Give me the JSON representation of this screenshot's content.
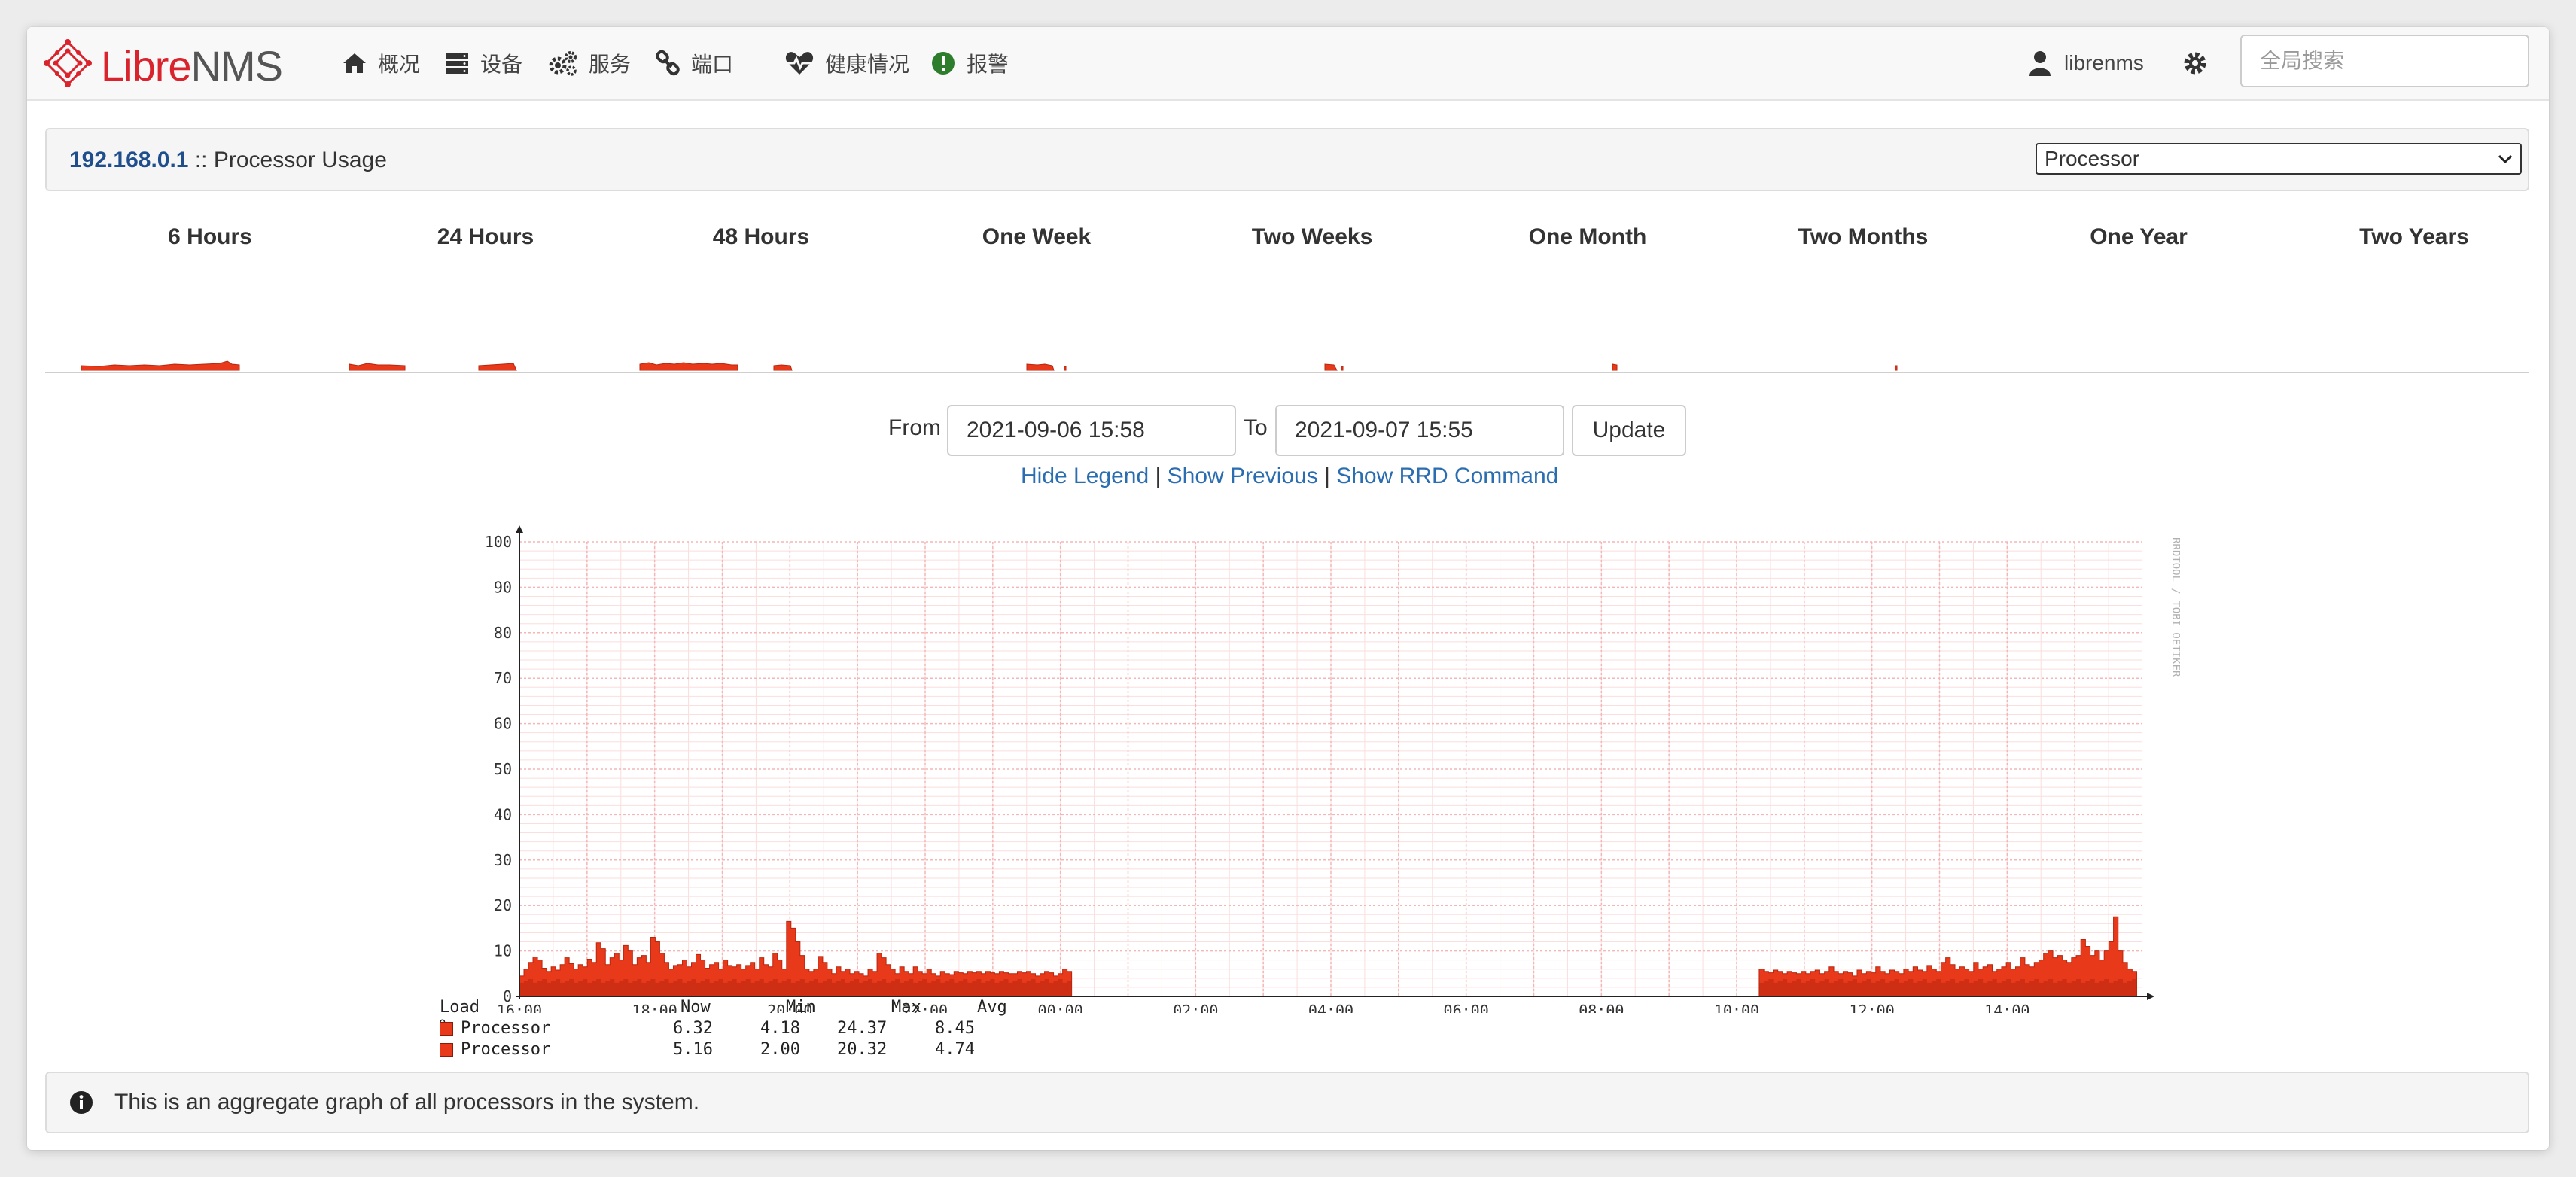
{
  "app": {
    "brand_prefix": "Libre",
    "brand_suffix": "NMS"
  },
  "nav": {
    "items": [
      {
        "label": "概况",
        "icon": "home-icon"
      },
      {
        "label": "设备",
        "icon": "server-icon"
      },
      {
        "label": "服务",
        "icon": "cogs-icon"
      },
      {
        "label": "端口",
        "icon": "link-icon"
      },
      {
        "label": "健康情况",
        "icon": "heartbeat-icon"
      },
      {
        "label": "报警",
        "icon": "alert-icon"
      }
    ],
    "user": "librenms",
    "search_placeholder": "全局搜索"
  },
  "panel": {
    "host": "192.168.0.1",
    "separator": " :: ",
    "title": "Processor Usage",
    "select_value": "Processor"
  },
  "periods": [
    "6 Hours",
    "24 Hours",
    "48 Hours",
    "One Week",
    "Two Weeks",
    "One Month",
    "Two Months",
    "One Year",
    "Two Years"
  ],
  "range": {
    "from_label": "From",
    "from_value": "2021-09-06 15:58",
    "to_label": "To",
    "to_value": "2021-09-07 15:55",
    "update_label": "Update"
  },
  "links": {
    "hide_legend": "Hide Legend",
    "show_previous": "Show Previous",
    "show_rrd": "Show RRD Command",
    "separator": "|"
  },
  "chart_data": {
    "type": "area",
    "watermark": "RRDTOOL / TOBI OETIKER",
    "ylim": [
      0,
      100
    ],
    "yticks": [
      0,
      10,
      20,
      30,
      40,
      50,
      60,
      70,
      80,
      90,
      100
    ],
    "x_start": "16:00",
    "x_end": "16:00",
    "xticks": [
      "16:00",
      "18:00",
      "20:00",
      "22:00",
      "00:00",
      "02:00",
      "04:00",
      "06:00",
      "08:00",
      "10:00",
      "12:00",
      "14:00"
    ],
    "colors": {
      "area": "#e8391a",
      "area_dark": "#b8260f",
      "grid": "#f4b6b6",
      "grid_minor": "#fbdede"
    },
    "gap": [
      "00:10",
      "10:20"
    ],
    "series": [
      {
        "name": "Processor",
        "segments": [
          {
            "start": "16:00",
            "end": "00:10",
            "values": [
              4.5,
              6,
              7.5,
              8.7,
              8,
              6.2,
              5.5,
              6.5,
              5.8,
              7,
              8.5,
              7.2,
              6,
              7,
              6.5,
              8.2,
              7.5,
              11.8,
              10.5,
              7,
              8.5,
              9.5,
              8,
              11.2,
              10,
              7,
              8.5,
              9,
              7.5,
              13,
              12,
              9.5,
              7.5,
              6,
              6.8,
              7,
              8,
              6.5,
              7.5,
              9.2,
              8,
              6.2,
              7,
              7.5,
              6,
              8,
              6.8,
              6.5,
              7,
              6,
              6.8,
              7.5,
              6,
              8.5,
              7,
              6.5,
              9.5,
              8,
              6,
              16.5,
              15,
              12,
              9,
              6,
              5.5,
              6,
              8.8,
              7.5,
              6,
              5,
              6.5,
              5.5,
              6,
              5,
              5.5,
              5,
              4.5,
              6,
              5.5,
              9.5,
              8.5,
              7,
              6,
              5,
              6.5,
              5.5,
              5,
              6.5,
              5.5,
              5,
              6,
              5,
              4.5,
              5.5,
              5,
              4.8,
              5.5,
              5.2,
              5,
              5.5,
              5.2,
              5.5,
              5,
              5.5,
              5.2,
              5,
              5.5,
              5.2,
              5,
              5,
              5.5,
              5.2,
              5.5,
              5,
              4.5,
              5,
              5.5,
              5.2,
              4.5,
              5,
              6,
              5.5
            ]
          },
          {
            "start": "10:20",
            "end": "15:55",
            "values": [
              6,
              5.5,
              5.2,
              5.8,
              5.5,
              5,
              5.5,
              5.2,
              5,
              5.5,
              5,
              5.5,
              5.8,
              5,
              5.5,
              6.5,
              5.5,
              5,
              5.5,
              5.2,
              4.5,
              5.8,
              5,
              5.5,
              5.2,
              6.5,
              5.5,
              5,
              5.8,
              5.5,
              5,
              6,
              5.5,
              6.5,
              5.8,
              5.5,
              6.8,
              6,
              5.5,
              7.5,
              8.5,
              7,
              6,
              6.5,
              6,
              5.5,
              7.5,
              6,
              6.5,
              7,
              5.5,
              6,
              6.5,
              7.5,
              6,
              6.5,
              8.5,
              7,
              6.5,
              7.5,
              8,
              9.5,
              10,
              8.5,
              9,
              8,
              7.5,
              8.5,
              9,
              12.5,
              11,
              9,
              10,
              8,
              10,
              12,
              17.5,
              10,
              7.5,
              6,
              5.5
            ]
          }
        ]
      }
    ],
    "legend": {
      "header": [
        "Load %",
        "Now",
        "Min",
        "Max",
        "Avg"
      ],
      "rows": [
        {
          "name": "Processor",
          "now": "6.32",
          "min": "4.18",
          "max": "24.37",
          "avg": "8.45"
        },
        {
          "name": "Processor",
          "now": "5.16",
          "min": "2.00",
          "max": "20.32",
          "avg": "4.74"
        }
      ]
    }
  },
  "info": {
    "text": "This is an aggregate graph of all processors in the system."
  }
}
